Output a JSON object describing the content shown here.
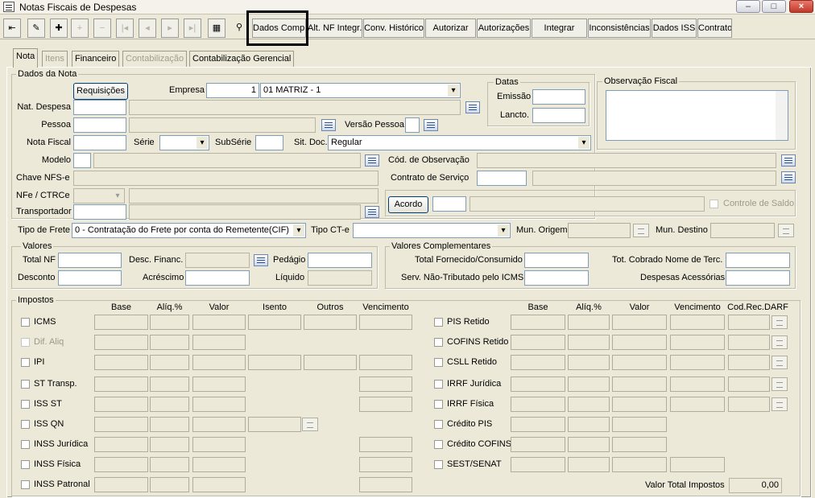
{
  "window": {
    "title": "Notas Fiscais de Despesas",
    "minimize": "–",
    "maximize": "□",
    "close": "×"
  },
  "toolbar": {
    "buttons": [
      "Dados Comp.",
      "Alt. NF Integr.",
      "Conv. Histórico",
      "Autorizar",
      "Autorizações",
      "Integrar",
      "Inconsistências",
      "Dados ISS",
      "Contrato"
    ]
  },
  "tabs": [
    "Nota",
    "Itens",
    "Financeiro",
    "Contabilização",
    "Contabilização Gerencial"
  ],
  "dados_nota": {
    "group": "Dados da Nota",
    "requisicoes": "Requisições",
    "empresa_label": "Empresa",
    "empresa_code": "1",
    "empresa_name": "01 MATRIZ - 1",
    "nat_despesa": "Nat. Despesa",
    "pessoa": "Pessoa",
    "versao_pessoa": "Versão Pessoa",
    "nota_fiscal": "Nota Fiscal",
    "serie": "Série",
    "subserie": "SubSérie",
    "sit_doc": "Sit. Doc.",
    "sit_doc_value": "Regular",
    "modelo": "Modelo",
    "cod_observacao": "Cód. de Observação",
    "chave_nfse": "Chave NFS-e",
    "contrato_servico": "Contrato de Serviço",
    "nfe_ctrce": "NFe / CTRCe",
    "acordo": "Acordo",
    "controle_saldo": "Controle de Saldo",
    "transportador": "Transportador",
    "tipo_frete": "Tipo de Frete",
    "tipo_frete_value": "0 - Contratação do Frete por conta do Remetente(CIF)",
    "tipo_cte": "Tipo CT-e",
    "mun_origem": "Mun. Origem",
    "mun_destino": "Mun. Destino"
  },
  "datas": {
    "group": "Datas",
    "emissao": "Emissão",
    "lancto": "Lancto."
  },
  "obs_fiscal": {
    "group": "Observação Fiscal"
  },
  "valores": {
    "group": "Valores",
    "total_nf": "Total NF",
    "desc_financ": "Desc. Financ.",
    "pedagio": "Pedágio",
    "desconto": "Desconto",
    "acrescimo": "Acréscimo",
    "liquido": "Líquido"
  },
  "valores_comp": {
    "group": "Valores Complementares",
    "total_fornecido": "Total Fornecido/Consumido",
    "tot_cobrado": "Tot. Cobrado Nome de Terc.",
    "serv_nao_trib": "Serv. Não-Tributado pelo ICMS",
    "despesas_acess": "Despesas Acessórias"
  },
  "impostos": {
    "group": "Impostos",
    "left_headers": [
      "Base",
      "Alíq.%",
      "Valor",
      "Isento",
      "Outros",
      "Vencimento"
    ],
    "right_headers": [
      "Base",
      "Alíq.%",
      "Valor",
      "Vencimento",
      "Cod.Rec.DARF"
    ],
    "left_rows": [
      "ICMS",
      "Dif. Aliq",
      "IPI",
      "ST Transp.",
      "ISS ST",
      "ISS QN",
      "INSS Jurídica",
      "INSS Física",
      "INSS Patronal"
    ],
    "right_rows": [
      "PIS Retido",
      "COFINS Retido",
      "CSLL Retido",
      "IRRF Jurídica",
      "IRRF Física",
      "Crédito PIS",
      "Crédito COFINS",
      "SEST/SENAT"
    ],
    "valor_total_label": "Valor Total Impostos",
    "valor_total": "0,00"
  }
}
